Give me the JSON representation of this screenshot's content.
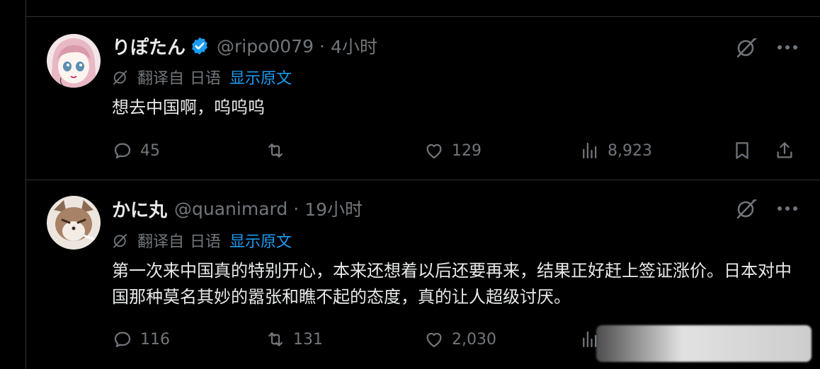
{
  "posts": [
    {
      "name": "りぽたん",
      "verified": true,
      "handle": "@ripo0079",
      "separator": "·",
      "time": "4小时",
      "translation": {
        "label": "翻译自",
        "language": "日语",
        "show_original": "显示原文"
      },
      "text": "想去中国啊，呜呜呜",
      "stats": {
        "replies": "45",
        "reposts": "",
        "likes": "129",
        "views": "8,923"
      }
    },
    {
      "name": "かに丸",
      "verified": false,
      "handle": "@quanimard",
      "separator": "·",
      "time": "19小时",
      "translation": {
        "label": "翻译自",
        "language": "日语",
        "show_original": "显示原文"
      },
      "text": "第一次来中国真的特别开心，本来还想着以后还要再来，结果正好赶上签证涨价。日本对中国那种莫名其妙的嚣张和瞧不起的态度，真的让人超级讨厌。",
      "stats": {
        "replies": "116",
        "reposts": "131",
        "likes": "2,030",
        "views": ""
      }
    }
  ],
  "icons": {
    "reply": "reply-icon",
    "repost": "repost-icon",
    "like": "like-icon",
    "views": "views-icon",
    "bookmark": "bookmark-icon",
    "share": "share-icon",
    "grok": "grok-icon",
    "more": "more-icon",
    "verified": "verified-badge-icon",
    "translate": "translate-icon"
  },
  "colors": {
    "background": "#000000",
    "text": "#e7e9ea",
    "muted": "#71767b",
    "link": "#1d9bf0",
    "verified": "#1d9bf0"
  }
}
